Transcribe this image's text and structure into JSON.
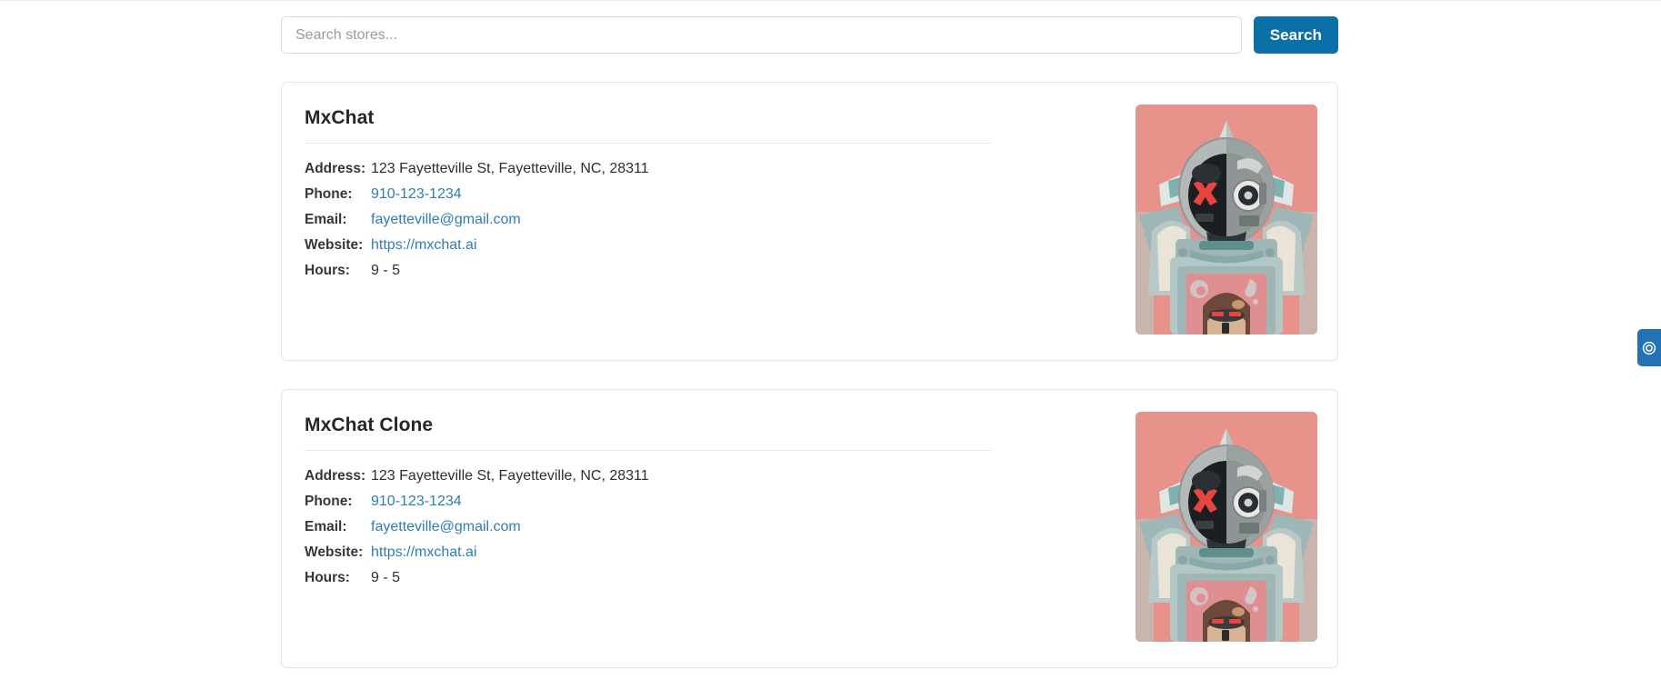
{
  "search": {
    "placeholder": "Search stores...",
    "value": "",
    "button_label": "Search",
    "button_color": "#0c70a8"
  },
  "labels": {
    "address": "Address:",
    "phone": "Phone:",
    "email": "Email:",
    "website": "Website:",
    "hours": "Hours:"
  },
  "stores": [
    {
      "name": "MxChat",
      "address": "123 Fayetteville St, Fayetteville, NC, 28311",
      "phone": "910-123-1234",
      "email": "fayetteville@gmail.com",
      "website": "https://mxchat.ai",
      "hours": "9 - 5",
      "image_alt": "robot-mascot-illustration"
    },
    {
      "name": "MxChat Clone",
      "address": "123 Fayetteville St, Fayetteville, NC, 28311",
      "phone": "910-123-1234",
      "email": "fayetteville@gmail.com",
      "website": "https://mxchat.ai",
      "hours": "9 - 5",
      "image_alt": "robot-mascot-illustration"
    }
  ],
  "edge_tab": {
    "icon": "target-circle-icon",
    "color": "#2372b3"
  },
  "colors": {
    "link": "#2e7db5",
    "text": "#2b2f33",
    "label": "#32373c",
    "card_border": "#e4e4e4",
    "image_background": "#e7928a"
  }
}
